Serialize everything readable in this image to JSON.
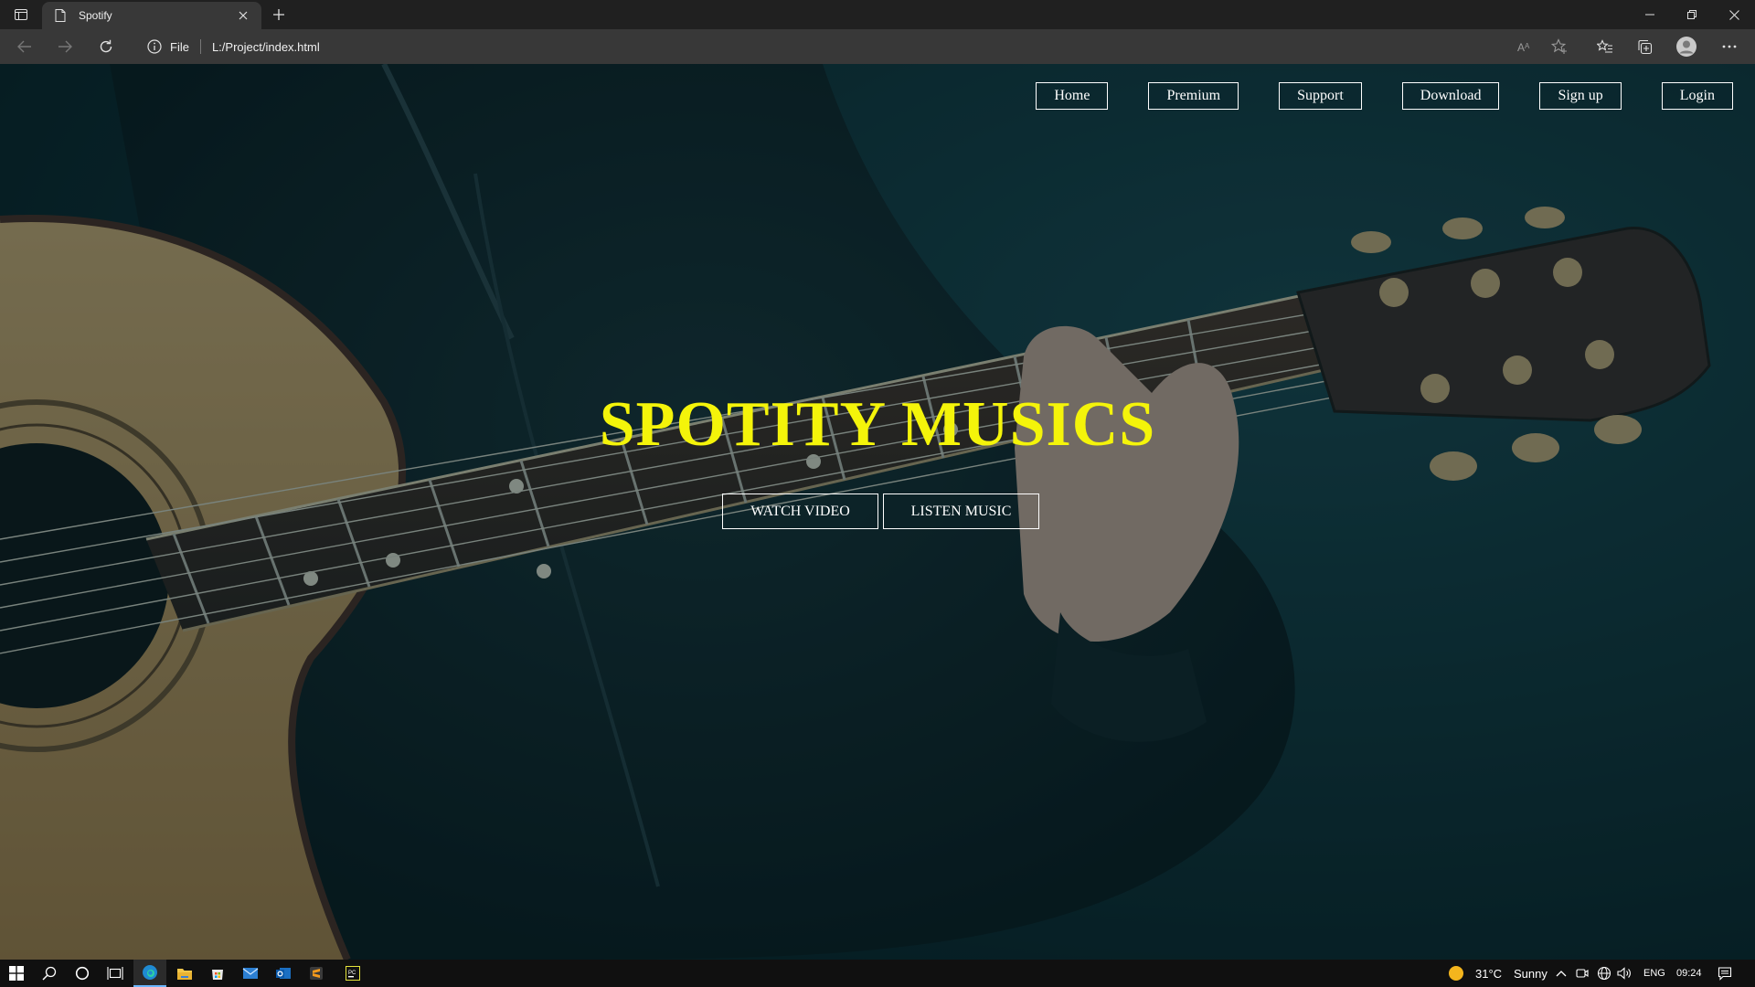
{
  "browser": {
    "tab_title": "Spotify",
    "omnibox": {
      "scheme": "File",
      "url": "L:/Project/index.html"
    }
  },
  "page": {
    "nav": [
      {
        "label": "Home"
      },
      {
        "label": "Premium"
      },
      {
        "label": "Support"
      },
      {
        "label": "Download"
      },
      {
        "label": "Sign up"
      },
      {
        "label": "Login"
      }
    ],
    "hero_title": "SPOTITY MUSICS",
    "buttons": {
      "watch": "WATCH VIDEO",
      "listen": "LISTEN MUSIC"
    },
    "colors": {
      "title": "#f4f40a",
      "overlay": "#0b2328",
      "button_border": "#ffffff"
    }
  },
  "taskbar": {
    "weather": {
      "temp": "31°C",
      "condition": "Sunny"
    },
    "language": "ENG",
    "time": "09:24"
  }
}
